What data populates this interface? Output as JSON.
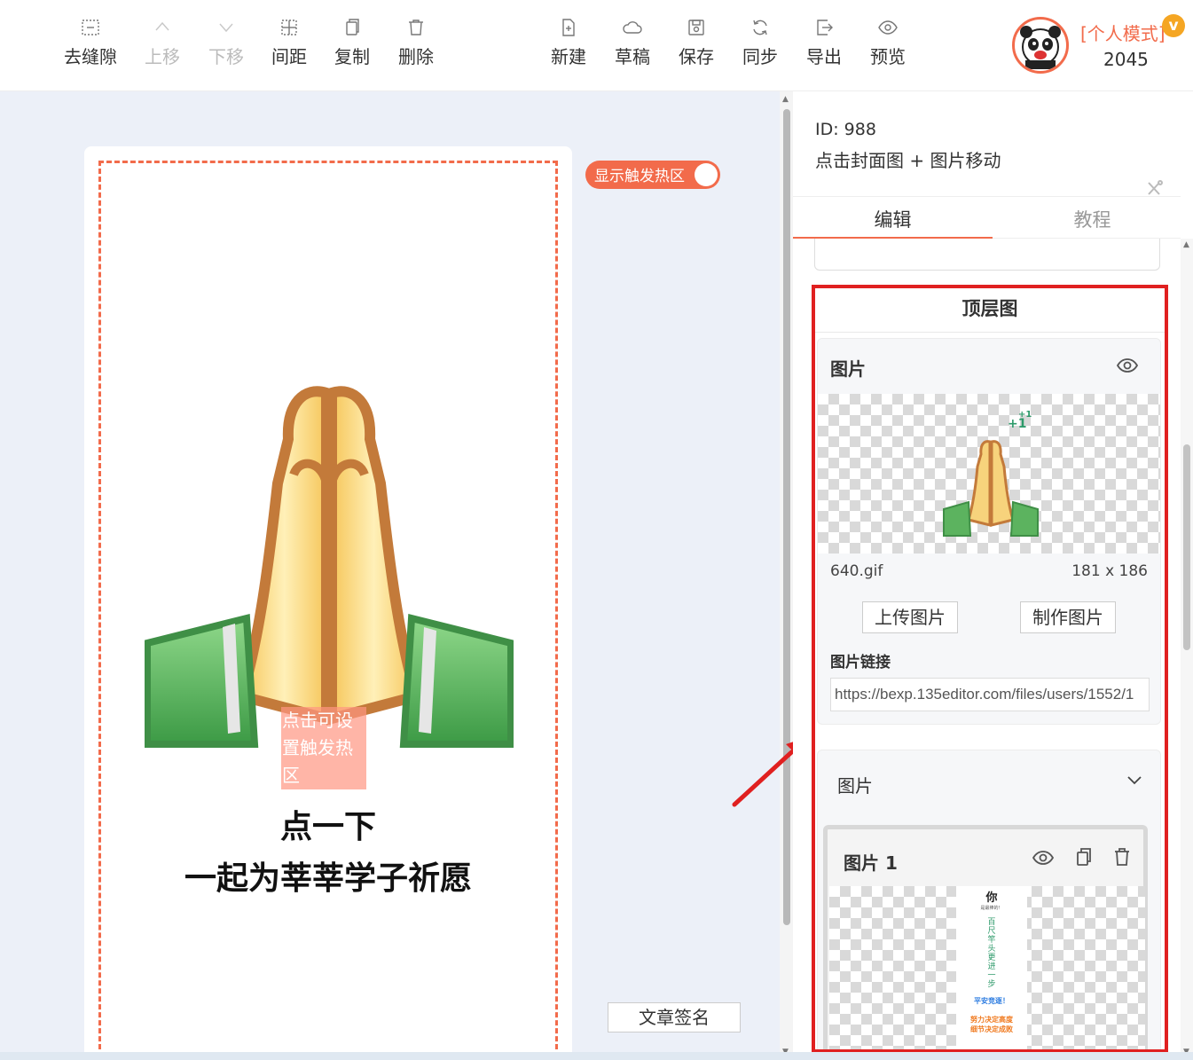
{
  "toolbar": {
    "left": [
      {
        "label": "去缝隙",
        "icon": "gap-icon"
      },
      {
        "label": "上移",
        "icon": "chevron-up-icon"
      },
      {
        "label": "下移",
        "icon": "chevron-down-icon"
      },
      {
        "label": "间距",
        "icon": "spacing-icon"
      },
      {
        "label": "复制",
        "icon": "copy-icon"
      },
      {
        "label": "删除",
        "icon": "trash-icon"
      }
    ],
    "right": [
      {
        "label": "新建",
        "icon": "new-file-icon"
      },
      {
        "label": "草稿",
        "icon": "cloud-icon"
      },
      {
        "label": "保存",
        "icon": "save-icon"
      },
      {
        "label": "同步",
        "icon": "sync-icon"
      },
      {
        "label": "导出",
        "icon": "export-icon"
      },
      {
        "label": "预览",
        "icon": "eye-icon"
      }
    ]
  },
  "user": {
    "mode": "[个人模式]",
    "vip": "v",
    "score": "2045"
  },
  "canvas": {
    "toggle_label": "显示触发热区",
    "hotzone_text": "点击可设置触发热区",
    "line1": "点一下",
    "line2": "一起为莘莘学子祈愿",
    "sign_button": "文章签名"
  },
  "panel": {
    "id_text": "ID: 988",
    "title": "点击封面图 + 图片移动",
    "tabs": [
      "编辑",
      "教程"
    ],
    "section_title": "顶层图",
    "image_card": {
      "title": "图片",
      "file_name": "640.gif",
      "file_size": "181 x 186",
      "upload_button": "上传图片",
      "make_button": "制作图片",
      "link_label": "图片链接",
      "link_value": "https://bexp.135editor.com/files/users/1552/1"
    },
    "group_card": {
      "title": "图片",
      "sub_title": "图片 1",
      "poster": {
        "t1": "你",
        "t2": "是最棒的！",
        "t3": "百尺竿头更进一步",
        "t4": "平安竞逐！",
        "t5": "努力决定高度",
        "t6": "细节决定成败"
      }
    }
  },
  "colors": {
    "accent": "#f26b4b",
    "highlight_border": "#e02020"
  }
}
